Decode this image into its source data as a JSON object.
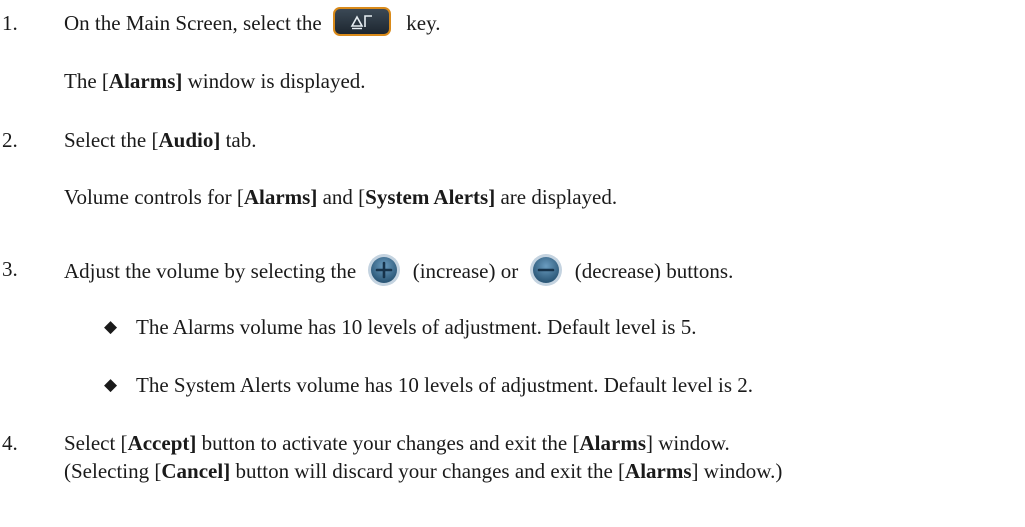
{
  "steps": [
    {
      "number": "1.",
      "before_icon": "On the Main Screen, select the",
      "icon": "alarm-settings-key-icon",
      "after_icon": "key.",
      "note_pre": "The [",
      "note_bold": "Alarms]",
      "note_post": " window is displayed."
    },
    {
      "number": "2.",
      "pre": "Select the [",
      "bold": "Audio]",
      "post": " tab.",
      "note_pre1": "Volume controls for [",
      "note_bold1": "Alarms]",
      "note_mid": " and [",
      "note_bold2": "System Alerts]",
      "note_post": " are displayed."
    },
    {
      "number": "3.",
      "pre": "Adjust the volume by selecting the",
      "plus_icon": "plus-circle-icon",
      "mid": "(increase) or",
      "minus_icon": "minus-circle-icon",
      "post": "(decrease) buttons.",
      "bullets": [
        "The Alarms volume has 10 levels of adjustment. Default level is 5.",
        "The System Alerts volume has 10 levels of adjustment. Default level is 2."
      ]
    },
    {
      "number": "4.",
      "l1_pre": "Select [",
      "l1_bold1": "Accept]",
      "l1_mid": " button to activate your changes and exit the [",
      "l1_bold2": "Alarms",
      "l1_post": "] window.",
      "l2_pre": "(Selecting [",
      "l2_bold1": "Cancel]",
      "l2_mid": " button will discard your changes and exit the [",
      "l2_bold2": "Alarms",
      "l2_post": "] window.)"
    }
  ],
  "colors": {
    "key_body": "#2a3540",
    "key_border": "#d98a1a",
    "round_body": "#3a6f96",
    "round_ring": "#c4d3e0"
  }
}
